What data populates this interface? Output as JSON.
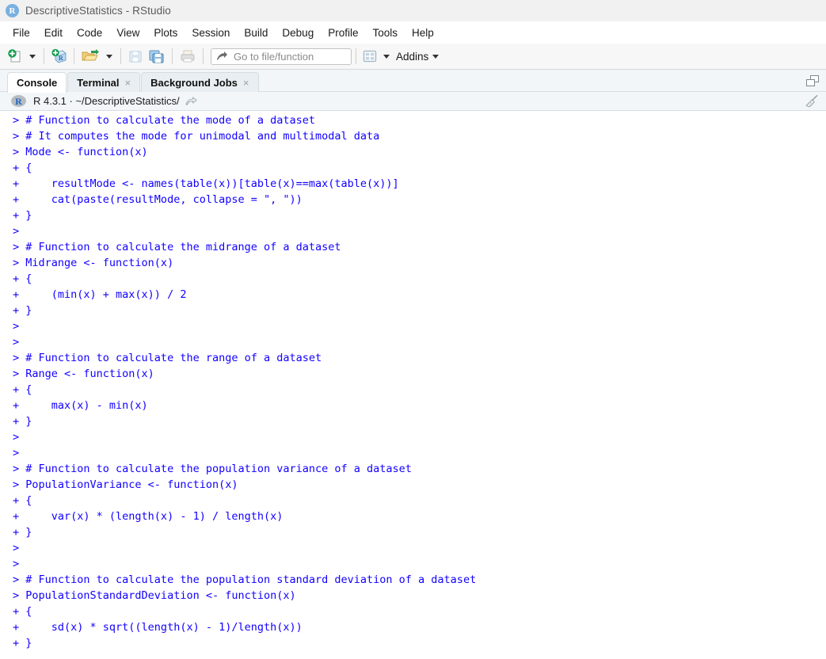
{
  "window": {
    "title": "DescriptiveStatistics - RStudio",
    "app_icon": "r-logo-icon"
  },
  "menubar": {
    "items": [
      {
        "label": "File"
      },
      {
        "label": "Edit"
      },
      {
        "label": "Code"
      },
      {
        "label": "View"
      },
      {
        "label": "Plots"
      },
      {
        "label": "Session"
      },
      {
        "label": "Build"
      },
      {
        "label": "Debug"
      },
      {
        "label": "Profile"
      },
      {
        "label": "Tools"
      },
      {
        "label": "Help"
      }
    ]
  },
  "toolbar": {
    "new_file_icon": "new-file-icon",
    "new_project_icon": "new-project-icon",
    "open_file_icon": "open-folder-icon",
    "save_icon": "save-icon",
    "save_all_icon": "save-all-icon",
    "print_icon": "print-icon",
    "goto_icon": "goto-arrow-icon",
    "goto_placeholder": "Go to file/function",
    "goto_value": "",
    "panes_icon": "workspace-panes-icon",
    "addins_label": "Addins"
  },
  "console_pane": {
    "tabs": [
      {
        "label": "Console",
        "active": true,
        "closable": false
      },
      {
        "label": "Terminal",
        "active": false,
        "closable": true
      },
      {
        "label": "Background Jobs",
        "active": false,
        "closable": true
      }
    ],
    "close_glyph": "×",
    "maximize_icon": "restore-pane-icon",
    "header": {
      "r_icon": "r-console-icon",
      "version_text": "R 4.3.1  ·  ~/DescriptiveStatistics/",
      "share_icon": "open-in-new-window-icon",
      "clear_icon": "broom-clear-console-icon"
    },
    "text_color": "#1200ff",
    "lines": [
      "> # Function to calculate the mode of a dataset",
      "> # It computes the mode for unimodal and multimodal data",
      "> Mode <- function(x)",
      "+ {",
      "+     resultMode <- names(table(x))[table(x)==max(table(x))]",
      "+     cat(paste(resultMode, collapse = \", \"))",
      "+ }",
      ">",
      "> # Function to calculate the midrange of a dataset",
      "> Midrange <- function(x)",
      "+ {",
      "+     (min(x) + max(x)) / 2",
      "+ }",
      ">",
      ">",
      "> # Function to calculate the range of a dataset",
      "> Range <- function(x)",
      "+ {",
      "+     max(x) - min(x)",
      "+ }",
      ">",
      ">",
      "> # Function to calculate the population variance of a dataset",
      "> PopulationVariance <- function(x)",
      "+ {",
      "+     var(x) * (length(x) - 1) / length(x)",
      "+ }",
      ">",
      ">",
      "> # Function to calculate the population standard deviation of a dataset",
      "> PopulationStandardDeviation <- function(x)",
      "+ {",
      "+     sd(x) * sqrt((length(x) - 1)/length(x))",
      "+ }"
    ]
  }
}
